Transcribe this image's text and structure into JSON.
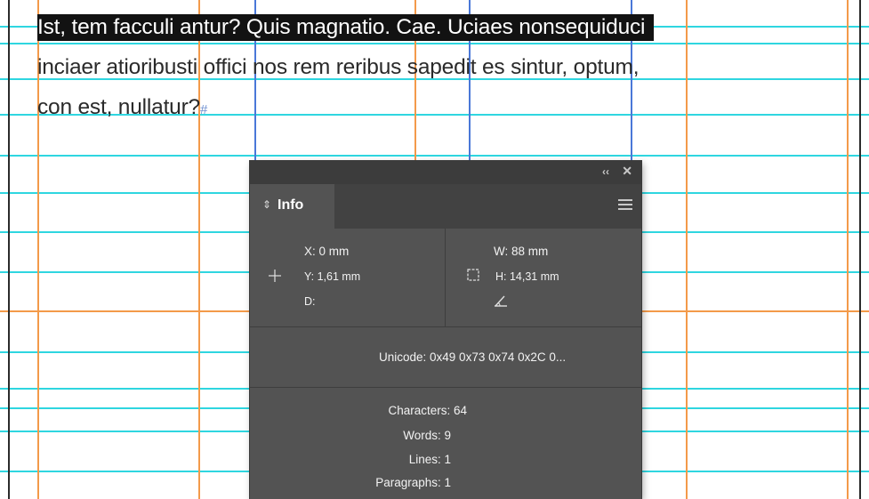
{
  "document": {
    "lines": [
      "Ist, tem facculi antur? Quis magnatio. Cae. Uciaes nonsequiduci",
      "inciaer atioribusti offici nos rem reribus sapedit es sintur, optum,",
      "con est, nullatur?"
    ],
    "pilcrow": "#"
  },
  "info_panel": {
    "collapse_glyph": "‹‹",
    "close_glyph": "✕",
    "tab": {
      "arrows": "⇕",
      "label": "Info"
    },
    "menu_icon": "hamburger-menu-icon",
    "position": {
      "x": "X: 0 mm",
      "y": "Y: 1,61 mm",
      "d": "D:"
    },
    "size": {
      "w": "W: 88 mm",
      "h": "H: 14,31 mm"
    },
    "unicode": "Unicode: 0x49 0x73 0x74 0x2C 0...",
    "stats": {
      "characters": "Characters: 64",
      "words": "Words: 9",
      "lines": "Lines: 1",
      "paragraphs": "Paragraphs: 1"
    }
  },
  "colors": {
    "guide_cyan": "#2fd6e0",
    "guide_orange": "#f39a4a",
    "guide_blue": "#4a78d8",
    "selection": "#121212",
    "panel_bg": "#535353"
  }
}
